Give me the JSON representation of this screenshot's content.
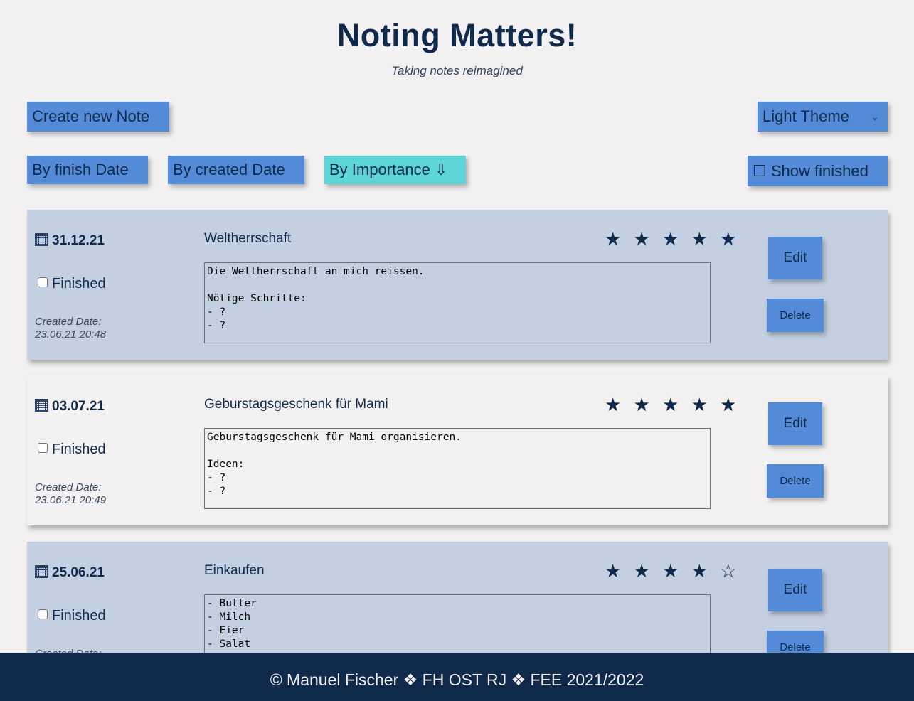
{
  "header": {
    "title": "Noting Matters!",
    "subtitle": "Taking notes reimagined"
  },
  "toolbar": {
    "create_label": "Create new Note",
    "theme_select": {
      "selected": "Light Theme"
    }
  },
  "sort": {
    "by_finish": "By finish Date",
    "by_created": "By created Date",
    "by_importance": "By Importance ⇩",
    "active": "By Importance"
  },
  "filter": {
    "show_finished": "☐ Show finished"
  },
  "notes": [
    {
      "due": "31.12.21",
      "finished_label": "Finished",
      "finished": false,
      "created_label": "Created Date:",
      "created": "23.06.21 20:48",
      "title": "Weltherrschaft",
      "stars": "★ ★ ★ ★ ★",
      "importance": 5,
      "body": "Die Weltherrschaft an mich reissen.\n\nNötige Schritte:\n- ?\n- ?",
      "edit_label": "Edit",
      "delete_label": "Delete"
    },
    {
      "due": "03.07.21",
      "finished_label": "Finished",
      "finished": false,
      "created_label": "Created Date:",
      "created": "23.06.21 20:49",
      "title": "Geburstagsgeschenk für Mami",
      "stars": "★ ★ ★ ★ ★",
      "importance": 5,
      "body": "Geburstagsgeschenk für Mami organisieren.\n\nIdeen:\n- ?\n- ?",
      "edit_label": "Edit",
      "delete_label": "Delete"
    },
    {
      "due": "25.06.21",
      "finished_label": "Finished",
      "finished": false,
      "created_label": "Created Date:",
      "created": "",
      "title": "Einkaufen",
      "stars": "★ ★ ★ ★ ☆",
      "importance": 4,
      "body": "- Butter\n- Milch\n- Eier\n- Salat",
      "edit_label": "Edit",
      "delete_label": "Delete"
    }
  ],
  "footer": {
    "text": "© Manuel Fischer ❖ FH OST RJ ❖ FEE 2021/2022"
  },
  "colors": {
    "background": "#f2f0f1",
    "primary_button": "#548bd8",
    "active_button": "#5cd4d8",
    "note_tint": "#c4cfe1",
    "text_dark": "#102a4c"
  }
}
